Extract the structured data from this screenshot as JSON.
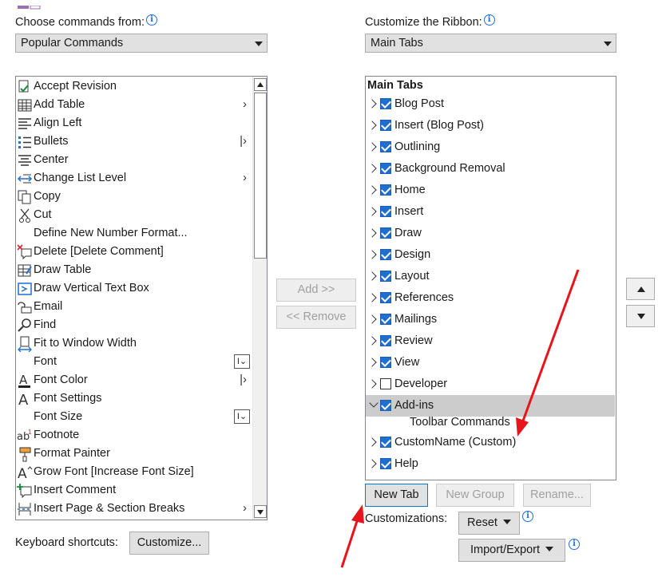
{
  "left": {
    "choose_label": "Choose commands from:",
    "choose_value": "Popular Commands",
    "commands": [
      {
        "label": "Accept Revision",
        "icon": "accept-revision-icon",
        "trail": ""
      },
      {
        "label": "Add Table",
        "icon": "table-icon",
        "trail": "submenu"
      },
      {
        "label": "Align Left",
        "icon": "align-left-icon",
        "trail": ""
      },
      {
        "label": "Bullets",
        "icon": "bullets-icon",
        "trail": "split"
      },
      {
        "label": "Center",
        "icon": "align-center-icon",
        "trail": ""
      },
      {
        "label": "Change List Level",
        "icon": "list-level-icon",
        "trail": "submenu"
      },
      {
        "label": "Copy",
        "icon": "copy-icon",
        "trail": ""
      },
      {
        "label": "Cut",
        "icon": "scissors-icon",
        "trail": ""
      },
      {
        "label": "Define New Number Format...",
        "icon": "",
        "trail": ""
      },
      {
        "label": "Delete [Delete Comment]",
        "icon": "delete-comment-icon",
        "trail": ""
      },
      {
        "label": "Draw Table",
        "icon": "draw-table-icon",
        "trail": ""
      },
      {
        "label": "Draw Vertical Text Box",
        "icon": "text-box-icon",
        "trail": ""
      },
      {
        "label": "Email",
        "icon": "email-icon",
        "trail": ""
      },
      {
        "label": "Find",
        "icon": "find-icon",
        "trail": ""
      },
      {
        "label": "Fit to Window Width",
        "icon": "fit-width-icon",
        "trail": ""
      },
      {
        "label": "Font",
        "icon": "",
        "trail": "field"
      },
      {
        "label": "Font Color",
        "icon": "font-color-icon",
        "trail": "split"
      },
      {
        "label": "Font Settings",
        "icon": "font-settings-icon",
        "trail": ""
      },
      {
        "label": "Font Size",
        "icon": "",
        "trail": "field"
      },
      {
        "label": "Footnote",
        "icon": "footnote-icon",
        "trail": ""
      },
      {
        "label": "Format Painter",
        "icon": "format-painter-icon",
        "trail": ""
      },
      {
        "label": "Grow Font [Increase Font Size]",
        "icon": "grow-font-icon",
        "trail": ""
      },
      {
        "label": "Insert Comment",
        "icon": "insert-comment-icon",
        "trail": ""
      },
      {
        "label": "Insert Page & Section Breaks",
        "icon": "page-break-icon",
        "trail": "submenu"
      }
    ],
    "keyboard_label": "Keyboard shortcuts:",
    "customize_button": "Customize..."
  },
  "middle": {
    "add_button": "Add >>",
    "remove_button": "<< Remove"
  },
  "right": {
    "customize_label": "Customize the Ribbon:",
    "customize_value": "Main Tabs",
    "tree_header": "Main Tabs",
    "tabs": [
      {
        "label": "Blog Post",
        "checked": true,
        "expanded": false
      },
      {
        "label": "Insert (Blog Post)",
        "checked": true,
        "expanded": false
      },
      {
        "label": "Outlining",
        "checked": true,
        "expanded": false
      },
      {
        "label": "Background Removal",
        "checked": true,
        "expanded": false
      },
      {
        "label": "Home",
        "checked": true,
        "expanded": false
      },
      {
        "label": "Insert",
        "checked": true,
        "expanded": false
      },
      {
        "label": "Draw",
        "checked": true,
        "expanded": false
      },
      {
        "label": "Design",
        "checked": true,
        "expanded": false
      },
      {
        "label": "Layout",
        "checked": true,
        "expanded": false
      },
      {
        "label": "References",
        "checked": true,
        "expanded": false
      },
      {
        "label": "Mailings",
        "checked": true,
        "expanded": false
      },
      {
        "label": "Review",
        "checked": true,
        "expanded": false
      },
      {
        "label": "View",
        "checked": true,
        "expanded": false
      },
      {
        "label": "Developer",
        "checked": false,
        "expanded": false
      },
      {
        "label": "Add-ins",
        "checked": true,
        "expanded": true,
        "selected": true
      }
    ],
    "addins_child": "Toolbar Commands",
    "tabs_after": [
      {
        "label": "CustomName (Custom)",
        "checked": true,
        "expanded": false
      },
      {
        "label": "Help",
        "checked": true,
        "expanded": false
      }
    ],
    "new_tab_button": "New Tab",
    "new_group_button": "New Group",
    "rename_button": "Rename...",
    "customizations_label": "Customizations:",
    "reset_button": "Reset",
    "import_export_button": "Import/Export"
  },
  "colors": {
    "accent": "#1f6fd1",
    "annotation_arrow": "#e8141c"
  }
}
